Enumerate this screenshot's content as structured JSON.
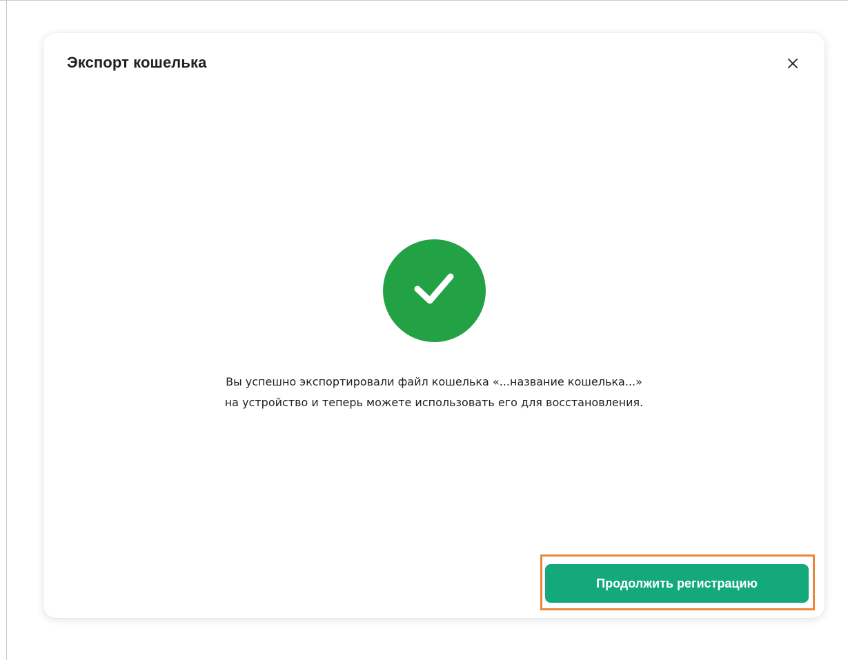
{
  "dialog": {
    "title": "Экспорт кошелька",
    "close_icon": "close-icon",
    "close_label": "X",
    "success_icon": "checkmark-icon",
    "success_color": "#22a244",
    "message_line1": "Вы успешно экспортировали файл кошелька «...название кошелька...»",
    "message_line2": "на устройство и теперь можете использовать его для восстановления.",
    "continue_label": "Продолжить регистрацию",
    "continue_color": "#14a97a",
    "highlight_color": "#e8873a"
  }
}
